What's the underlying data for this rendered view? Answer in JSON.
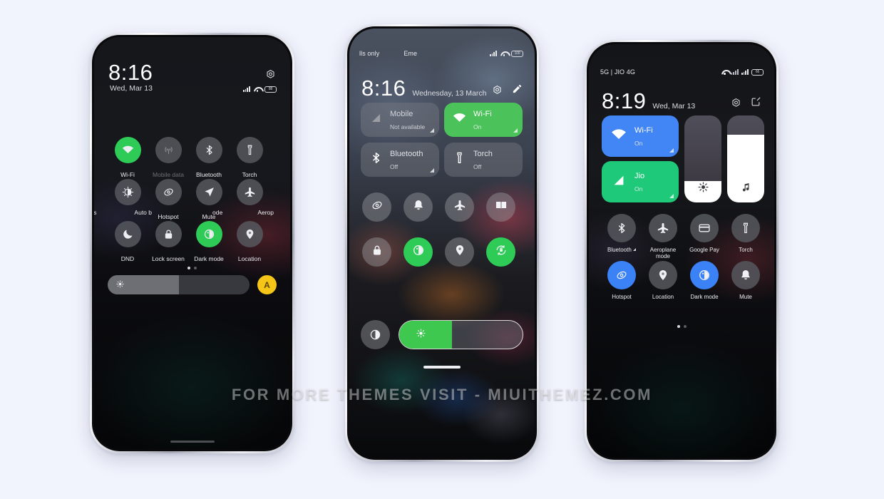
{
  "page": {
    "background_color": "#f1f3fd",
    "watermark": "FOR MORE THEMES VISIT - MIUITHEMEZ.COM"
  },
  "phone1": {
    "status_bar": {
      "signal": "signal-bars-icon",
      "wifi": "wifi-icon",
      "battery": "88"
    },
    "header": {
      "time": "8:16",
      "date": "Wed, Mar 13",
      "settings_icon": "gear-hex-icon"
    },
    "rows": [
      [
        {
          "label": "Wi-Fi",
          "icon": "wifi-icon",
          "state": "on-green"
        },
        {
          "label": "Mobile data",
          "icon": "cell-tower-icon",
          "state": "off-dim"
        },
        {
          "label": "Bluetooth",
          "icon": "bluetooth-icon",
          "state": "off"
        },
        {
          "label": "Torch",
          "icon": "torch-icon",
          "state": "off"
        }
      ],
      [
        {
          "label_left": "ss",
          "label": "Auto b",
          "icon": "brightness-icon",
          "state": "off"
        },
        {
          "label": "Hotspot",
          "icon": "hotspot-icon",
          "state": "off"
        },
        {
          "label": "Mute",
          "icon": "mute-arrow-icon",
          "state": "off"
        },
        {
          "label_left": "ode",
          "label": "Aerop",
          "icon": "aeroplane-icon",
          "state": "off"
        }
      ],
      [
        {
          "label": "DND",
          "icon": "moon-icon",
          "state": "off"
        },
        {
          "label": "Lock screen",
          "icon": "lock-icon",
          "state": "off"
        },
        {
          "label": "Dark mode",
          "icon": "dark-mode-icon",
          "state": "on-green"
        },
        {
          "label": "Location",
          "icon": "location-pin-icon",
          "state": "off"
        }
      ]
    ],
    "pager": {
      "count": 2,
      "active": 0
    },
    "brightness": {
      "icon": "sun-icon",
      "value": 50
    },
    "auto_button": {
      "label": "A",
      "color": "#f5c518"
    }
  },
  "phone2": {
    "status_bar": {
      "carrier_left": "lls only",
      "carrier_right": "Eme",
      "signal": "signal-bars-icon",
      "wifi": "wifi-icon",
      "battery": "100"
    },
    "header": {
      "time": "8:16",
      "date": "Wednesday, 13 March",
      "settings_icon": "gear-hex-icon",
      "edit_icon": "pencil-icon"
    },
    "big_tiles": [
      {
        "title": "Mobile",
        "subtitle": "Not available",
        "icon": "signal-triangle-icon",
        "state": "muted"
      },
      {
        "title": "Wi-Fi",
        "subtitle": "On",
        "icon": "wifi-icon",
        "state": "green"
      },
      {
        "title": "Bluetooth",
        "subtitle": "Off",
        "icon": "bluetooth-icon",
        "state": "grey"
      },
      {
        "title": "Torch",
        "subtitle": "Off",
        "icon": "torch-icon",
        "state": "grey"
      }
    ],
    "circle_rows": [
      [
        {
          "icon": "hotspot-icon",
          "state": "off"
        },
        {
          "icon": "bell-icon",
          "state": "off"
        },
        {
          "icon": "aeroplane-icon",
          "state": "off"
        },
        {
          "icon": "reading-mode-icon",
          "state": "off"
        }
      ],
      [
        {
          "icon": "lock-icon",
          "state": "off"
        },
        {
          "icon": "dark-mode-icon",
          "state": "on-green"
        },
        {
          "icon": "location-pin-icon",
          "state": "off"
        },
        {
          "icon": "rotation-lock-icon",
          "state": "on-green"
        }
      ]
    ],
    "brightness": {
      "icon_left": "brightness-contrast-icon",
      "icon": "sun-icon",
      "value": 43
    },
    "home_indicator": true
  },
  "phone3": {
    "status_bar": {
      "carrier": "5G | JIO 4G",
      "wifi": "wifi-icon",
      "signal": "signal-bars-icon",
      "battery": "66"
    },
    "header": {
      "time": "8:19",
      "date": "Wed, Mar 13",
      "settings_icon": "gear-hex-icon",
      "edit_icon": "edit-square-icon"
    },
    "big_tiles": [
      {
        "title": "Wi-Fi",
        "subtitle": "On",
        "icon": "wifi-icon",
        "state": "blue"
      },
      {
        "title": "Jio",
        "subtitle": "On",
        "icon": "signal-triangle-icon",
        "state": "green2"
      }
    ],
    "v_sliders": [
      {
        "icon": "sun-icon",
        "value": 25,
        "name": "brightness-slider"
      },
      {
        "icon": "music-note-icon",
        "value": 78,
        "name": "media-volume-slider"
      }
    ],
    "rows": [
      [
        {
          "label": "Bluetooth",
          "icon": "bluetooth-icon",
          "state": "off",
          "has_corner": true
        },
        {
          "label": "Aeroplane mode",
          "icon": "aeroplane-icon",
          "state": "off"
        },
        {
          "label": "Google Pay",
          "icon": "card-icon",
          "state": "off"
        },
        {
          "label": "Torch",
          "icon": "torch-icon",
          "state": "off"
        }
      ],
      [
        {
          "label": "Hotspot",
          "icon": "hotspot-icon",
          "state": "on-blue"
        },
        {
          "label": "Location",
          "icon": "location-pin-icon",
          "state": "off"
        },
        {
          "label": "Dark mode",
          "icon": "dark-mode-icon",
          "state": "on-blue"
        },
        {
          "label": "Mute",
          "icon": "bell-icon",
          "state": "off"
        }
      ]
    ],
    "pager": {
      "count": 2,
      "active": 0
    }
  }
}
